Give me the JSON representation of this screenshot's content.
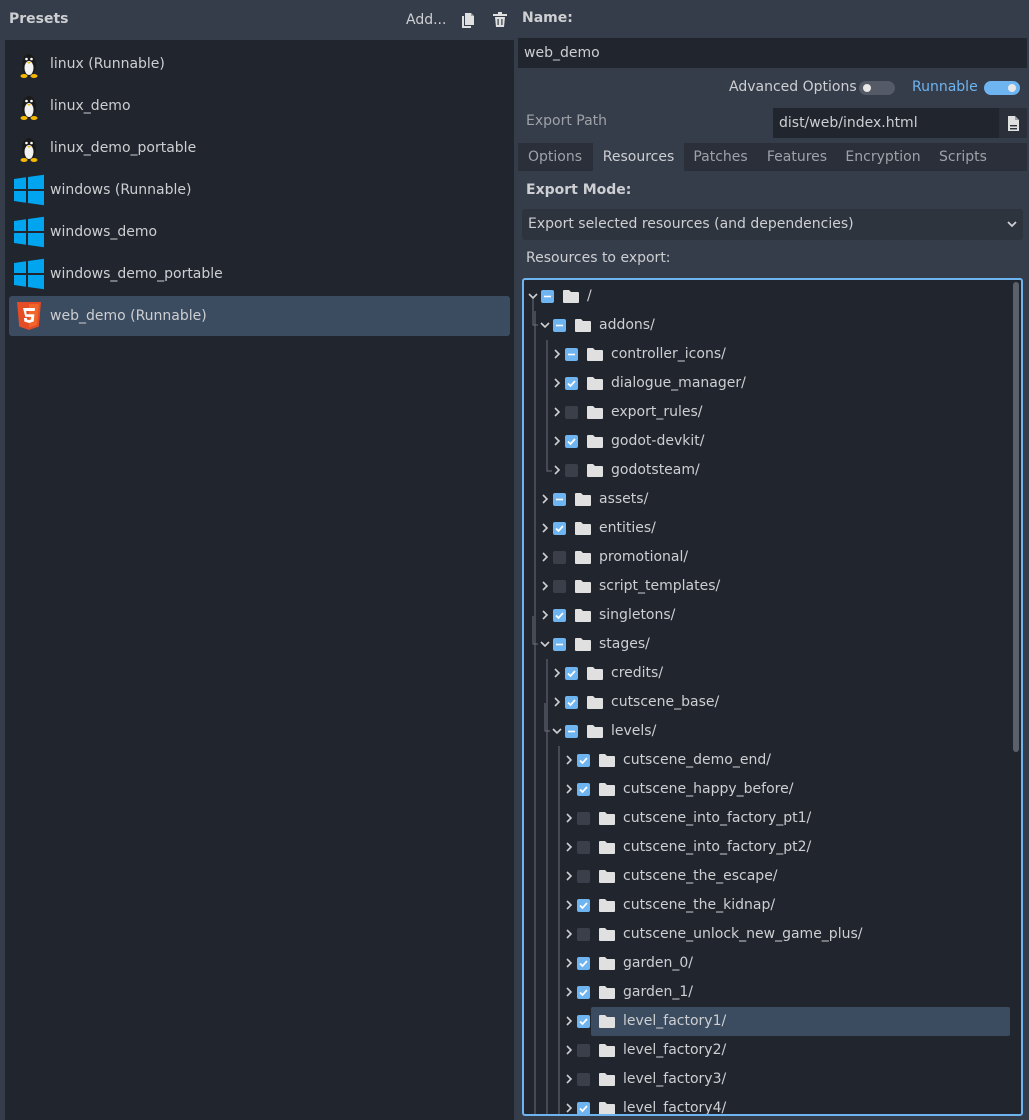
{
  "presets": {
    "title": "Presets",
    "add_label": "Add...",
    "items": [
      {
        "label": "linux (Runnable)",
        "platform": "linux-icon"
      },
      {
        "label": "linux_demo",
        "platform": "linux-icon"
      },
      {
        "label": "linux_demo_portable",
        "platform": "linux-icon"
      },
      {
        "label": "windows (Runnable)",
        "platform": "windows-icon"
      },
      {
        "label": "windows_demo",
        "platform": "windows-icon"
      },
      {
        "label": "windows_demo_portable",
        "platform": "windows-icon"
      },
      {
        "label": "web_demo (Runnable)",
        "platform": "html5-icon",
        "selected": true
      }
    ]
  },
  "details": {
    "name_label": "Name:",
    "name_value": "web_demo",
    "advanced_label": "Advanced Options",
    "advanced_on": false,
    "runnable_label": "Runnable",
    "runnable_on": true,
    "export_path_label": "Export Path",
    "export_path_value": "dist/web/index.html",
    "tabs": [
      "Options",
      "Resources",
      "Patches",
      "Features",
      "Encryption",
      "Scripts"
    ],
    "active_tab": "Resources",
    "export_mode_label": "Export Mode:",
    "export_mode_value": "Export selected resources (and dependencies)",
    "resources_label": "Resources to export:"
  },
  "tree": [
    {
      "label": "/",
      "depth": 0,
      "state": "partial",
      "expanded": true
    },
    {
      "label": "addons/",
      "depth": 1,
      "state": "partial",
      "expanded": true
    },
    {
      "label": "controller_icons/",
      "depth": 2,
      "state": "partial",
      "expanded": false
    },
    {
      "label": "dialogue_manager/",
      "depth": 2,
      "state": "checked",
      "expanded": false
    },
    {
      "label": "export_rules/",
      "depth": 2,
      "state": "unchecked",
      "expanded": false
    },
    {
      "label": "godot-devkit/",
      "depth": 2,
      "state": "checked",
      "expanded": false
    },
    {
      "label": "godotsteam/",
      "depth": 2,
      "state": "unchecked",
      "expanded": false
    },
    {
      "label": "assets/",
      "depth": 1,
      "state": "partial",
      "expanded": false
    },
    {
      "label": "entities/",
      "depth": 1,
      "state": "checked",
      "expanded": false
    },
    {
      "label": "promotional/",
      "depth": 1,
      "state": "unchecked",
      "expanded": false
    },
    {
      "label": "script_templates/",
      "depth": 1,
      "state": "unchecked",
      "expanded": false
    },
    {
      "label": "singletons/",
      "depth": 1,
      "state": "checked",
      "expanded": false
    },
    {
      "label": "stages/",
      "depth": 1,
      "state": "partial",
      "expanded": true
    },
    {
      "label": "credits/",
      "depth": 2,
      "state": "checked",
      "expanded": false
    },
    {
      "label": "cutscene_base/",
      "depth": 2,
      "state": "checked",
      "expanded": false
    },
    {
      "label": "levels/",
      "depth": 2,
      "state": "partial",
      "expanded": true
    },
    {
      "label": "cutscene_demo_end/",
      "depth": 3,
      "state": "checked",
      "expanded": false
    },
    {
      "label": "cutscene_happy_before/",
      "depth": 3,
      "state": "checked",
      "expanded": false
    },
    {
      "label": "cutscene_into_factory_pt1/",
      "depth": 3,
      "state": "unchecked",
      "expanded": false
    },
    {
      "label": "cutscene_into_factory_pt2/",
      "depth": 3,
      "state": "unchecked",
      "expanded": false
    },
    {
      "label": "cutscene_the_escape/",
      "depth": 3,
      "state": "unchecked",
      "expanded": false
    },
    {
      "label": "cutscene_the_kidnap/",
      "depth": 3,
      "state": "checked",
      "expanded": false
    },
    {
      "label": "cutscene_unlock_new_game_plus/",
      "depth": 3,
      "state": "unchecked",
      "expanded": false
    },
    {
      "label": "garden_0/",
      "depth": 3,
      "state": "checked",
      "expanded": false
    },
    {
      "label": "garden_1/",
      "depth": 3,
      "state": "checked",
      "expanded": false
    },
    {
      "label": "level_factory1/",
      "depth": 3,
      "state": "checked",
      "expanded": false,
      "selected": true
    },
    {
      "label": "level_factory2/",
      "depth": 3,
      "state": "unchecked",
      "expanded": false
    },
    {
      "label": "level_factory3/",
      "depth": 3,
      "state": "unchecked",
      "expanded": false
    },
    {
      "label": "level_factory4/",
      "depth": 3,
      "state": "checked",
      "expanded": false
    }
  ],
  "colors": {
    "accent": "#6eb4f0",
    "panel": "#363d4a",
    "field": "#21252e",
    "selection": "#3b4b60"
  }
}
